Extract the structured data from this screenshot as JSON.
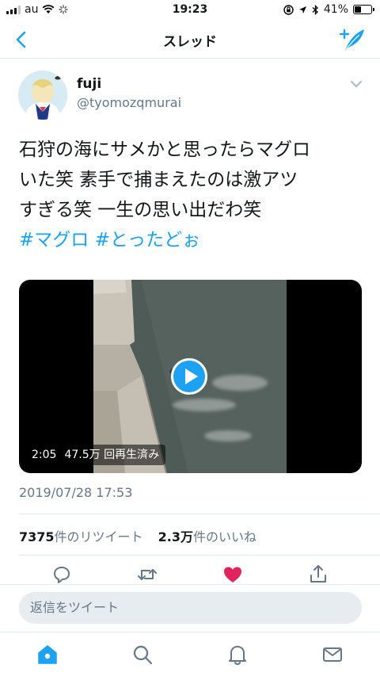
{
  "status_bar": {
    "carrier": "au",
    "time": "19:23",
    "battery_percent": "41%",
    "battery_level": 0.41,
    "icons": [
      "signal-icon",
      "wifi-icon",
      "loading-icon",
      "screen-lock-icon",
      "location-icon",
      "bluetooth-icon",
      "battery-icon"
    ]
  },
  "nav": {
    "title": "スレッド",
    "back_icon": "back-chevron-icon",
    "compose_icon": "compose-tweet-icon"
  },
  "tweet": {
    "display_name": "fuji",
    "handle": "@tyomozqmurai",
    "text_lines": [
      "石狩の海にサメかと思ったらマグロ",
      "いた笑  素手で捕まえたのは激アツ",
      "すぎる笑   一生の思い出だわ笑"
    ],
    "hashtags": [
      "#マグロ",
      "#とったどぉ"
    ],
    "video": {
      "duration": "2:05",
      "views": "47.5万 回再生済み"
    },
    "date": "2019/07/28 17:53",
    "retweet_count": "7375",
    "retweet_label": "件のリツイート",
    "like_count": "2.3万",
    "like_label": "件のいいね",
    "liked": true
  },
  "reply": {
    "placeholder": "返信をツイート"
  },
  "colors": {
    "accent": "#1da1f2",
    "like": "#e0245e",
    "secondary_text": "#657786",
    "divider": "#e1e8ed"
  },
  "tabs": [
    "home-icon",
    "search-icon",
    "notifications-icon",
    "messages-icon"
  ]
}
